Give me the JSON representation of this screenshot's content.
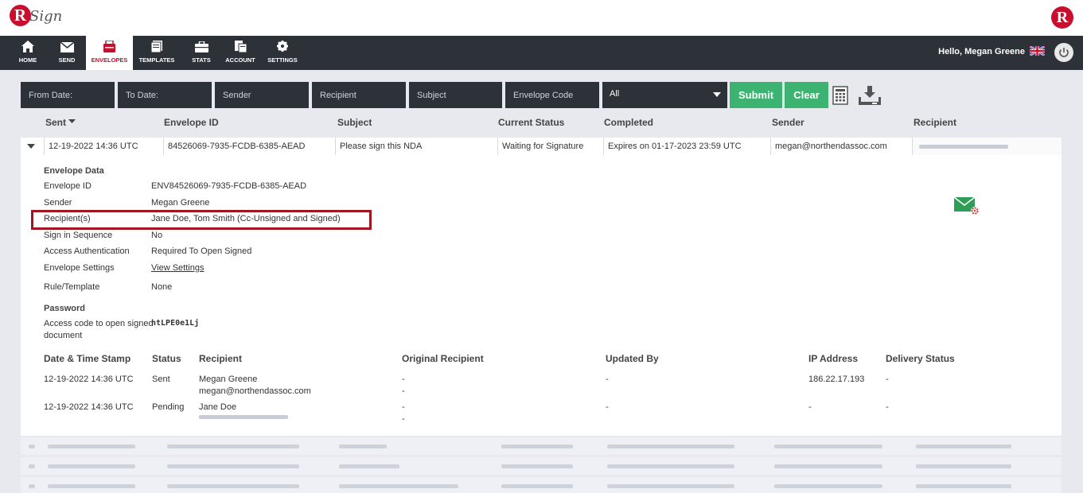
{
  "brand": {
    "logo_letter": "R",
    "logo_text": "Sign",
    "right_letter": "R"
  },
  "nav": {
    "items": [
      {
        "label": "HOME",
        "icon": "home-icon"
      },
      {
        "label": "SEND",
        "icon": "mail-icon"
      },
      {
        "label": "ENVELOPES",
        "icon": "envelopes-icon"
      },
      {
        "label": "TEMPLATES",
        "icon": "templates-icon"
      },
      {
        "label": "STATS",
        "icon": "briefcase-icon"
      },
      {
        "label": "ACCOUNT",
        "icon": "account-icon"
      },
      {
        "label": "SETTINGS",
        "icon": "gear-icon"
      }
    ],
    "active": "ENVELOPES",
    "greeting": "Hello, Megan Greene"
  },
  "filters": {
    "from_date": "From Date:",
    "to_date": "To Date:",
    "sender": "Sender",
    "recipient": "Recipient",
    "subject": "Subject",
    "envelope_code": "Envelope Code",
    "status_select": "All",
    "submit": "Submit",
    "clear": "Clear"
  },
  "columns": {
    "sent": "Sent",
    "envelope_id": "Envelope ID",
    "subject": "Subject",
    "current_status": "Current Status",
    "completed": "Completed",
    "sender": "Sender",
    "recipient": "Recipient"
  },
  "row": {
    "sent": "12-19-2022 14:36 UTC",
    "envelope_id": "84526069-7935-FCDB-6385-AEAD",
    "subject": "Please sign this NDA",
    "status": "Waiting for Signature",
    "completed": "Expires on 01-17-2023 23:59 UTC",
    "sender": "megan@northendassoc.com"
  },
  "envelope_data": {
    "heading": "Envelope Data",
    "fields": [
      {
        "label": "Envelope ID",
        "value": "ENV84526069-7935-FCDB-6385-AEAD"
      },
      {
        "label": "Sender",
        "value": "Megan Greene"
      },
      {
        "label": "Recipient(s)",
        "value": "Jane Doe, Tom Smith (Cc-Unsigned and Signed)"
      },
      {
        "label": "Sign in Sequence",
        "value": "No"
      },
      {
        "label": "Access Authentication",
        "value": "Required To Open Signed"
      },
      {
        "label": "Envelope Settings",
        "value": "View Settings"
      },
      {
        "label": "Rule/Template",
        "value": "None"
      }
    ],
    "password_heading": "Password",
    "access_code_label_1": "Access code to open signed",
    "access_code_label_2": "document",
    "access_code": "htLPE0e1Lj"
  },
  "history": {
    "headers": {
      "timestamp": "Date & Time Stamp",
      "status": "Status",
      "recipient": "Recipient",
      "original": "Original Recipient",
      "updated_by": "Updated By",
      "ip": "IP Address",
      "delivery": "Delivery Status"
    },
    "rows": [
      {
        "timestamp": "12-19-2022 14:36 UTC",
        "status": "Sent",
        "name": "Megan Greene",
        "email": "megan@northendassoc.com",
        "original1": "-",
        "original2": "-",
        "updated_by": "-",
        "ip": "186.22.17.193",
        "delivery": "-"
      },
      {
        "timestamp": "12-19-2022 14:36 UTC",
        "status": "Pending",
        "name": "Jane Doe",
        "email": "",
        "original1": "-",
        "original2": "-",
        "updated_by": "-",
        "ip": "-",
        "delivery": "-"
      }
    ]
  },
  "colors": {
    "accent_red": "#c8102e",
    "nav_dark": "#2d3138",
    "green": "#3cb371",
    "highlight_border": "#a31621"
  }
}
